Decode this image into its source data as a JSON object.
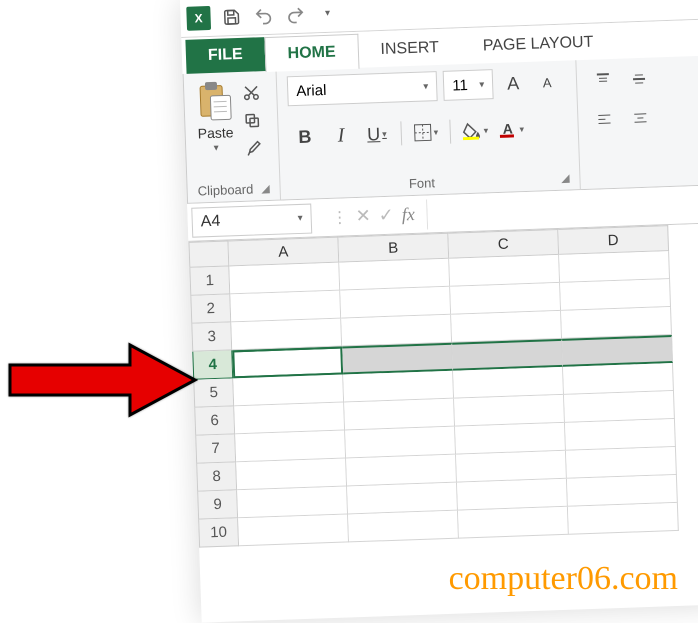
{
  "qat": {
    "app_abbrev": "X"
  },
  "tabs": {
    "file": "FILE",
    "home": "HOME",
    "insert": "INSERT",
    "page_layout": "PAGE LAYOUT"
  },
  "ribbon": {
    "clipboard": {
      "paste": "Paste",
      "title": "Clipboard"
    },
    "font": {
      "name": "Arial",
      "size": "11",
      "grow": "A",
      "shrink": "A",
      "bold": "B",
      "italic": "I",
      "underline": "U",
      "title": "Font"
    }
  },
  "namebox": {
    "ref": "A4"
  },
  "formula": {
    "fx": "fx",
    "value": ""
  },
  "columns": [
    "A",
    "B",
    "C",
    "D"
  ],
  "rows": [
    "1",
    "2",
    "3",
    "4",
    "5",
    "6",
    "7",
    "8",
    "9",
    "10"
  ],
  "selected_row": "4",
  "watermark": "computer06.com"
}
